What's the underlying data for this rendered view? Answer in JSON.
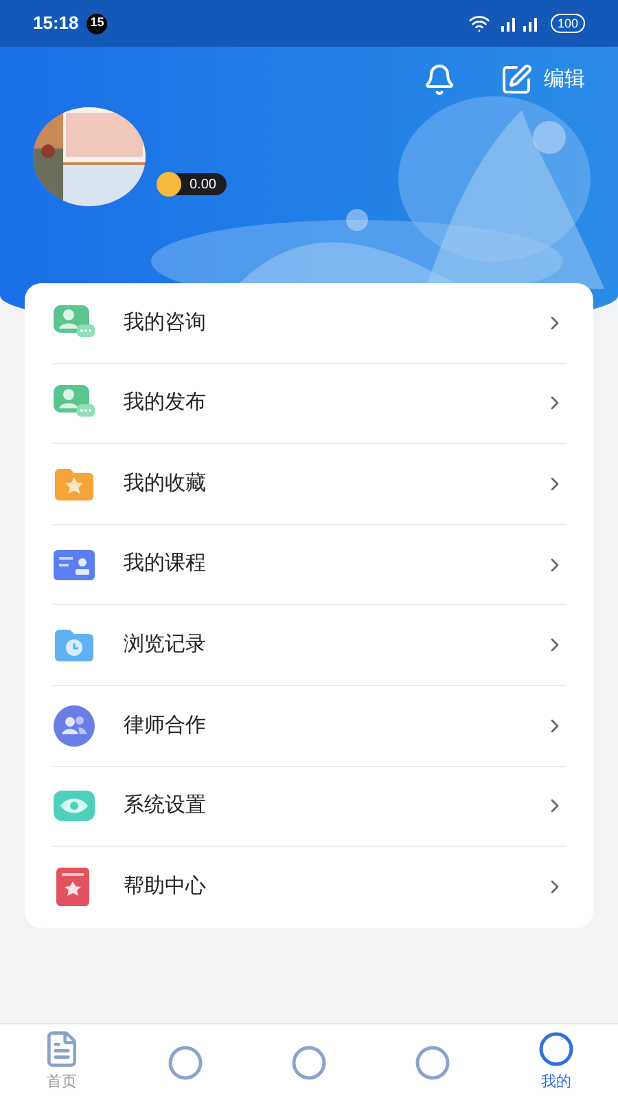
{
  "status_bar": {
    "time": "15:18",
    "badge": "15",
    "battery": "100"
  },
  "header": {
    "edit_label": "编辑",
    "balance": "0.00"
  },
  "menu": [
    {
      "label": "我的咨询"
    },
    {
      "label": "我的发布"
    },
    {
      "label": "我的收藏"
    },
    {
      "label": "我的课程"
    },
    {
      "label": "浏览记录"
    },
    {
      "label": "律师合作"
    },
    {
      "label": "系统设置"
    },
    {
      "label": "帮助中心"
    }
  ],
  "tab_bar": [
    {
      "label": "首页",
      "selected": false
    },
    {
      "selected": false
    },
    {
      "selected": false
    },
    {
      "selected": false
    },
    {
      "label": "我的",
      "selected": true
    }
  ]
}
